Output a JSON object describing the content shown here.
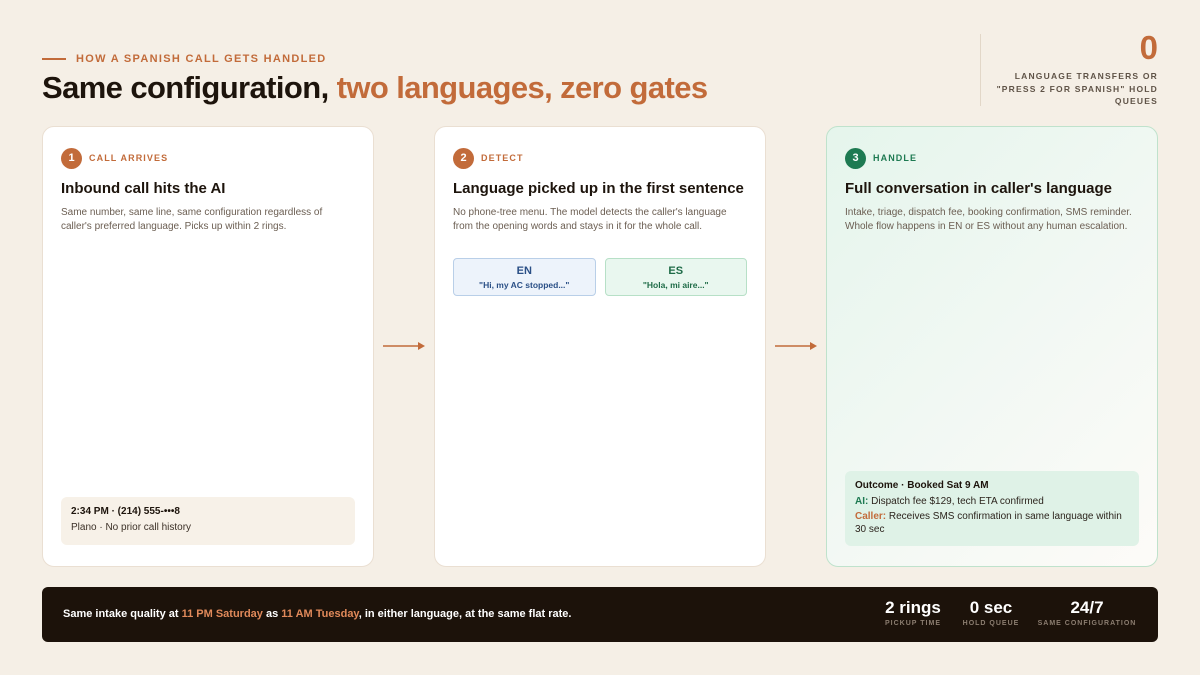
{
  "header": {
    "eyebrow": "HOW A SPANISH CALL GETS HANDLED",
    "title_plain": "Same configuration, ",
    "title_accent": "two languages, zero gates"
  },
  "stat": {
    "value": "0",
    "label": "LANGUAGE TRANSFERS OR \"PRESS 2 FOR SPANISH\" HOLD QUEUES"
  },
  "cards": [
    {
      "step": "1",
      "step_label": "CALL ARRIVES",
      "title": "Inbound call hits the AI",
      "desc": "Same number, same line, same configuration regardless of caller's preferred language. Picks up within 2 rings.",
      "call_info": {
        "line1": "2:34 PM · (214) 555-•••8",
        "line2": "Plano · No prior call history"
      }
    },
    {
      "step": "2",
      "step_label": "DETECT",
      "title": "Language picked up in the first sentence",
      "desc": "No phone-tree menu. The model detects the caller's language from the opening words and stays in it for the whole call.",
      "languages": [
        {
          "code": "EN",
          "quote": "\"Hi, my AC stopped...\""
        },
        {
          "code": "ES",
          "quote": "\"Hola, mi aire...\""
        }
      ]
    },
    {
      "step": "3",
      "step_label": "HANDLE",
      "title": "Full conversation in caller's language",
      "desc": "Intake, triage, dispatch fee, booking confirmation, SMS reminder. Whole flow happens in EN or ES without any human escalation.",
      "outcome": {
        "title": "Outcome · Booked Sat 9 AM",
        "ai_label": "AI:",
        "ai_text": " Dispatch fee $129, tech ETA confirmed",
        "caller_label": "Caller:",
        "caller_text": " Receives SMS confirmation in same language within 30 sec"
      }
    }
  ],
  "footer": {
    "s_a": "Same intake quality at ",
    "s_b": "11 PM Saturday",
    "s_c": " as ",
    "s_d": "11 AM Tuesday",
    "s_e": ", in either language, at the same flat rate.",
    "stats": [
      {
        "value": "2 rings",
        "label": "PICKUP TIME"
      },
      {
        "value": "0 sec",
        "label": "HOLD QUEUE"
      },
      {
        "value": "24/7",
        "label": "SAME CONFIGURATION"
      }
    ]
  },
  "colors": {
    "accent": "#c26b3a",
    "success": "#1e7a52",
    "background": "#f5efe6",
    "footer_bg": "#1c120a"
  }
}
